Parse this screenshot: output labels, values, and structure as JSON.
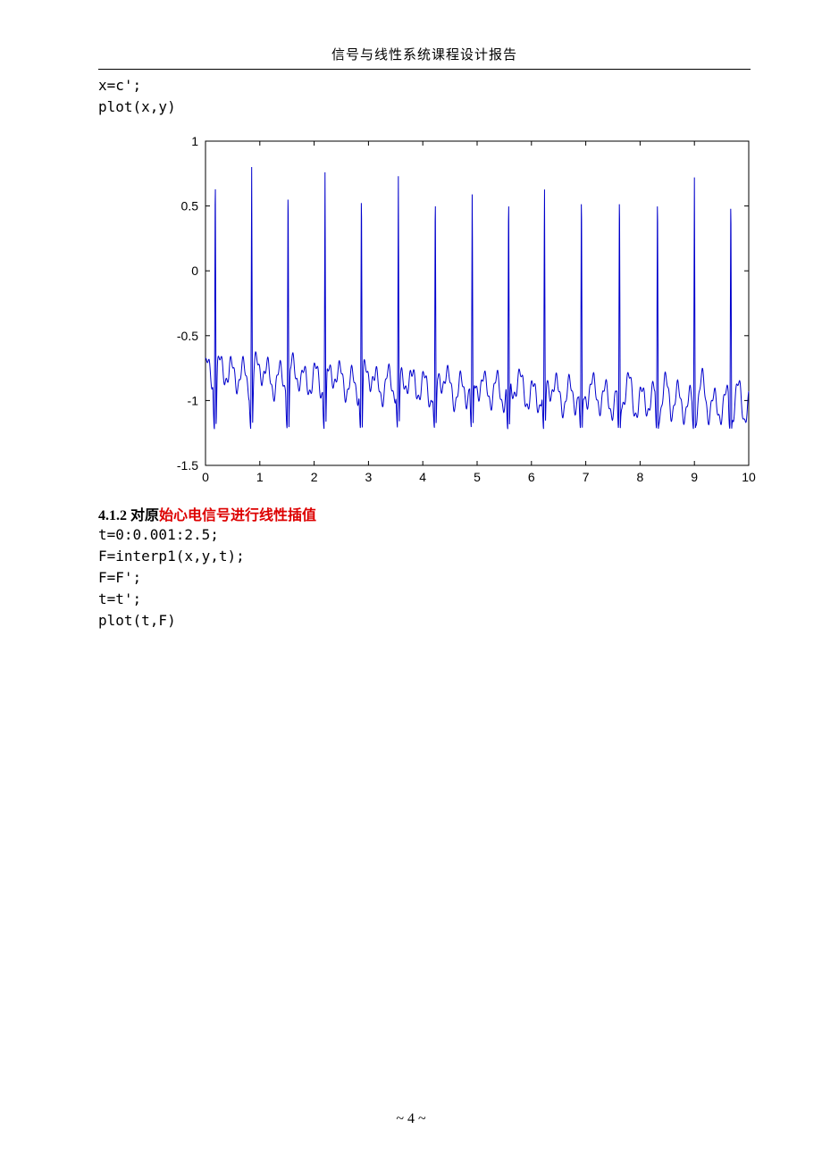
{
  "header": {
    "title": "信号与线性系统课程设计报告"
  },
  "code_block_1": "x=c';\nplot(x,y)",
  "section": {
    "number": "4.1.2",
    "black_part": " 对原",
    "red_part": "始心电信号进行线性插值"
  },
  "code_block_2": "t=0:0.001:2.5;\nF=interp1(x,y,t);\nF=F';\nt=t';\nplot(t,F)",
  "footer": {
    "page": "~ 4 ~"
  },
  "chart_data": {
    "type": "line",
    "title": "",
    "xlabel": "",
    "ylabel": "",
    "xlim": [
      0,
      10
    ],
    "ylim": [
      -1.5,
      1
    ],
    "xticks": [
      0,
      1,
      2,
      3,
      4,
      5,
      6,
      7,
      8,
      9,
      10
    ],
    "yticks": [
      -1.5,
      -1,
      -0.5,
      0,
      0.5,
      1
    ],
    "color": "#0000cc",
    "spikes": [
      {
        "x": 0.18,
        "peak": 0.87,
        "trough": -1.22
      },
      {
        "x": 0.85,
        "peak": 0.8,
        "trough": -1.22
      },
      {
        "x": 1.52,
        "peak": 0.78,
        "trough": -1.22
      },
      {
        "x": 2.2,
        "peak": 0.76,
        "trough": -1.22
      },
      {
        "x": 2.87,
        "peak": 0.75,
        "trough": -1.22
      },
      {
        "x": 3.55,
        "peak": 0.73,
        "trough": -1.21
      },
      {
        "x": 4.23,
        "peak": 0.72,
        "trough": -1.21
      },
      {
        "x": 4.91,
        "peak": 0.7,
        "trough": -1.21
      },
      {
        "x": 5.58,
        "peak": 0.72,
        "trough": -1.22
      },
      {
        "x": 6.24,
        "peak": 0.74,
        "trough": -1.22
      },
      {
        "x": 6.92,
        "peak": 0.74,
        "trough": -1.22
      },
      {
        "x": 7.62,
        "peak": 0.74,
        "trough": -1.22
      },
      {
        "x": 8.32,
        "peak": 0.72,
        "trough": -1.22
      },
      {
        "x": 9.0,
        "peak": 0.72,
        "trough": -1.22
      },
      {
        "x": 9.67,
        "peak": 0.7,
        "trough": -1.22
      }
    ],
    "baseline_start": -0.8,
    "baseline_end": -1.05,
    "baseline_noise_amp": 0.12,
    "baseline_noise_freq": 4.5,
    "baseline_noise_freq2": 13,
    "baseline_noise_amp2": 0.04
  }
}
